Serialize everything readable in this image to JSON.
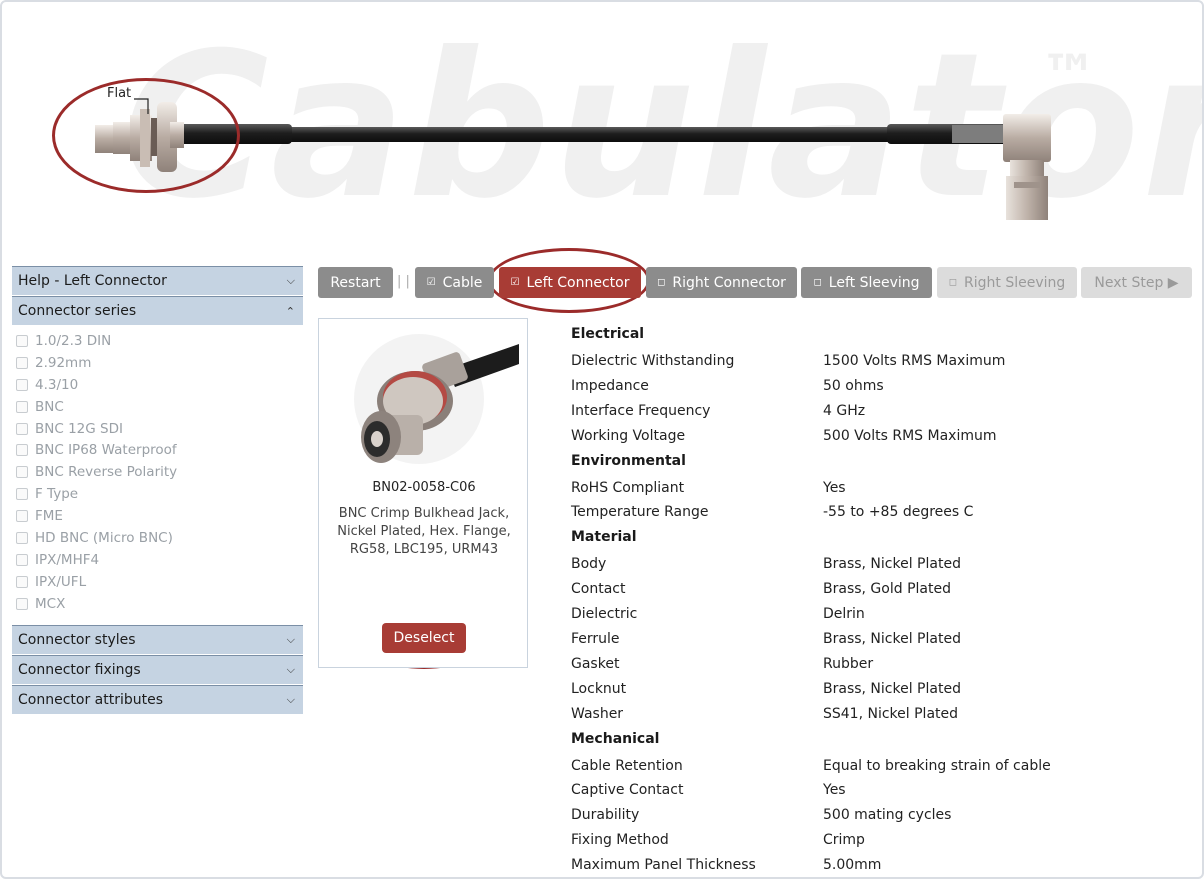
{
  "banner": {
    "watermark": "Cabulator",
    "trademark": "™",
    "flat_label": "Flat"
  },
  "sidebar": {
    "help": {
      "label": "Help - Left Connector"
    },
    "connector_series": {
      "label": "Connector series",
      "items": [
        "1.0/2.3 DIN",
        "2.92mm",
        "4.3/10",
        "BNC",
        "BNC 12G SDI",
        "BNC IP68 Waterproof",
        "BNC Reverse Polarity",
        "F Type",
        "FME",
        "HD BNC (Micro BNC)",
        "IPX/MHF4",
        "IPX/UFL",
        "MCX"
      ]
    },
    "connector_styles": {
      "label": "Connector styles"
    },
    "connector_fixings": {
      "label": "Connector fixings"
    },
    "connector_attributes": {
      "label": "Connector attributes"
    }
  },
  "toolbar": {
    "restart": "Restart",
    "separator": "| |",
    "check": "☑",
    "box": "◻",
    "cable": "Cable",
    "left_connector": "Left Connector",
    "right_connector": "Right Connector",
    "left_sleeving": "Left Sleeving",
    "right_sleeving": "Right Sleeving",
    "next_step": "Next Step ▶"
  },
  "product": {
    "sku": "BN02-0058-C06",
    "description": "BNC Crimp Bulkhead Jack, Nickel Plated, Hex. Flange, RG58, LBC195, URM43",
    "deselect": "Deselect"
  },
  "specs": {
    "electrical": {
      "title": "Electrical",
      "rows": [
        [
          "Dielectric Withstanding",
          "1500 Volts RMS Maximum"
        ],
        [
          "Impedance",
          "50 ohms"
        ],
        [
          "Interface Frequency",
          "4 GHz"
        ],
        [
          "Working Voltage",
          "500 Volts RMS Maximum"
        ]
      ]
    },
    "environmental": {
      "title": "Environmental",
      "rows": [
        [
          "RoHS Compliant",
          "Yes"
        ],
        [
          "Temperature Range",
          "-55 to +85 degrees C"
        ]
      ]
    },
    "material": {
      "title": "Material",
      "rows": [
        [
          "Body",
          "Brass, Nickel Plated"
        ],
        [
          "Contact",
          "Brass, Gold Plated"
        ],
        [
          "Dielectric",
          "Delrin"
        ],
        [
          "Ferrule",
          "Brass, Nickel Plated"
        ],
        [
          "Gasket",
          "Rubber"
        ],
        [
          "Locknut",
          "Brass, Nickel Plated"
        ],
        [
          "Washer",
          "SS41, Nickel Plated"
        ]
      ]
    },
    "mechanical": {
      "title": "Mechanical",
      "rows": [
        [
          "Cable Retention",
          "Equal to breaking strain of cable"
        ],
        [
          "Captive Contact",
          "Yes"
        ],
        [
          "Durability",
          "500 mating cycles"
        ],
        [
          "Fixing Method",
          "Crimp"
        ],
        [
          "Maximum Panel Thickness",
          "5.00mm"
        ]
      ]
    }
  },
  "colors": {
    "accent": "#a83c35",
    "highlight_oval": "#9b2b2a",
    "accordion": "#c5d3e2",
    "button_grey": "#8c8c8c"
  }
}
